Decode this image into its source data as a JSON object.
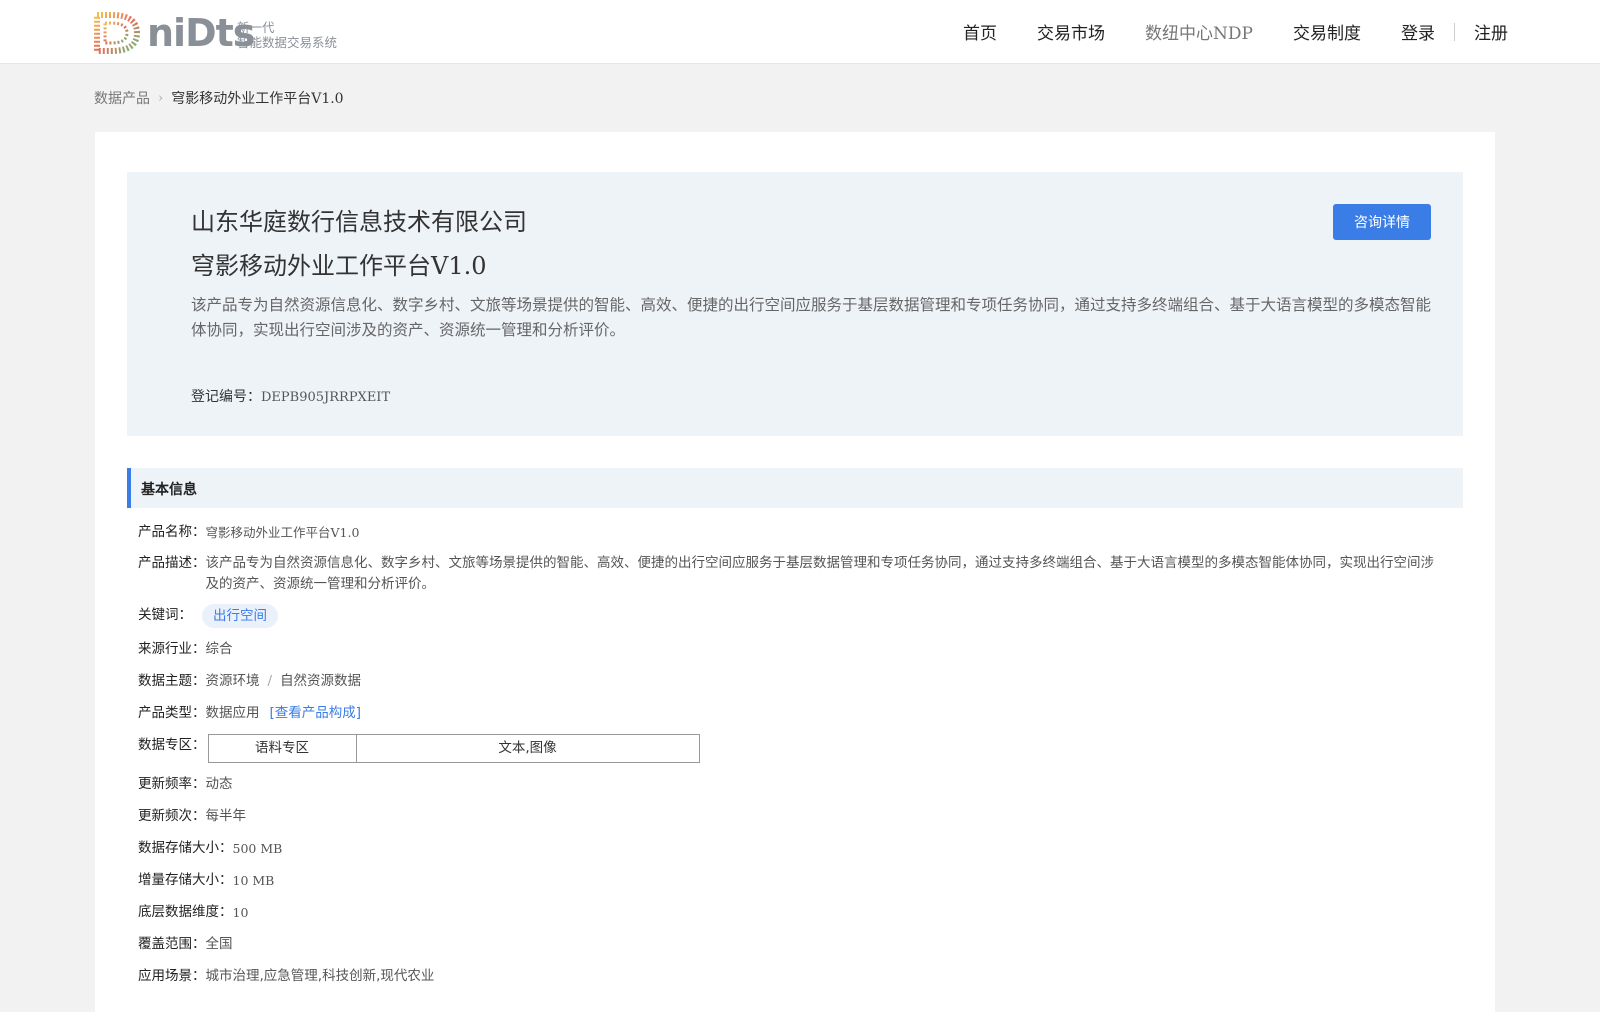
{
  "header": {
    "logo_word": "niDts",
    "logo_tag_line1": "新一代",
    "logo_tag_line2": "智能数据交易系统",
    "nav": [
      "首页",
      "交易市场",
      "数纽中心NDP",
      "交易制度",
      "登录",
      "注册"
    ]
  },
  "breadcrumb": {
    "parent": "数据产品",
    "current": "穹影移动外业工作平台V1.0"
  },
  "hero": {
    "company": "山东华庭数行信息技术有限公司",
    "product": "穹影移动外业工作平台V1.0",
    "description": "该产品专为自然资源信息化、数字乡村、文旅等场景提供的智能、高效、便捷的出行空间应服务于基层数据管理和专项任务协同，通过支持多终端组合、基于大语言模型的多模态智能体协同，实现出行空间涉及的资产、资源统一管理和分析评价。",
    "reg_label": "登记编号：",
    "reg_value": "DEPB905JRRPXEIT",
    "consult_button": "咨询详情"
  },
  "basic_info": {
    "section_title": "基本信息",
    "product_name_label": "产品名称：",
    "product_name": "穹影移动外业工作平台V1.0",
    "description_label": "产品描述：",
    "description": "该产品专为自然资源信息化、数字乡村、文旅等场景提供的智能、高效、便捷的出行空间应服务于基层数据管理和专项任务协同，通过支持多终端组合、基于大语言模型的多模态智能体协同，实现出行空间涉及的资产、资源统一管理和分析评价。",
    "keywords_label": "关键词：",
    "keyword": "出行空间",
    "industry_label": "来源行业：",
    "industry": "综合",
    "topic_label": "数据主题：",
    "topic_main": "资源环境",
    "topic_sub": "自然资源数据",
    "type_label": "产品类型：",
    "type": "数据应用",
    "type_link": "[查看产品构成]",
    "zone_label": "数据专区：",
    "zone_name": "语料专区",
    "zone_value": "文本,图像",
    "freq_label": "更新频率：",
    "freq": "动态",
    "times_label": "更新频次：",
    "times": "每半年",
    "storage_label": "数据存储大小：",
    "storage": "500 MB",
    "incr_label": "增量存储大小：",
    "incr": "10 MB",
    "dim_label": "底层数据维度：",
    "dim": "10",
    "coverage_label": "覆盖范围：",
    "coverage": "全国",
    "scenario_label": "应用场景：",
    "scenario": "城市治理,应急管理,科技创新,现代农业"
  }
}
